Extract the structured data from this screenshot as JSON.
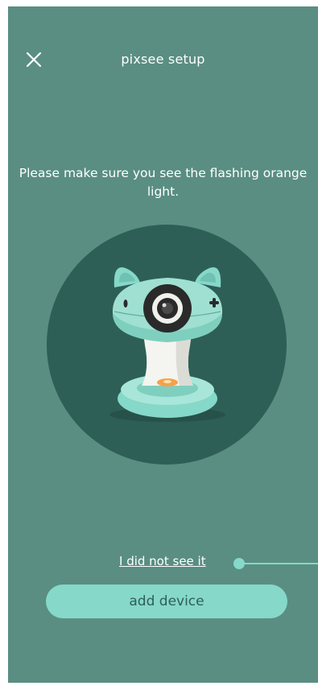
{
  "header": {
    "title": "pixsee setup",
    "close_icon": "close-icon"
  },
  "instruction": {
    "text": "Please make sure you see the flashing orange light."
  },
  "illustration": {
    "icon": "pixsee-camera-illustration",
    "circle_color": "#2e5f56",
    "light_color": "#f5a14a"
  },
  "actions": {
    "not_seen_link": "I did not see it",
    "add_device_label": "add device"
  },
  "colors": {
    "background": "#5a8e82",
    "accent": "#86d8c8",
    "accent_text": "#2e5f56"
  }
}
